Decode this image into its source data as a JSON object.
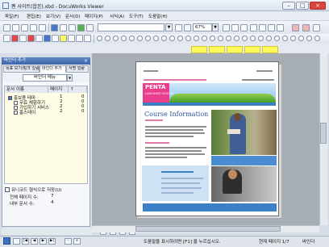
{
  "window": {
    "title": "펜 사이트(합본).xbd - DocuWorks Viewer"
  },
  "menu": {
    "items": [
      "파일(F)",
      "편집(E)",
      "보기(V)",
      "문서(D)",
      "페이지(P)",
      "서식(A)",
      "도구(T)",
      "도움말(H)"
    ]
  },
  "toolbar": {
    "zoom_value": "67%",
    "zoom_arrow": "▼",
    "style_arrow": "▼"
  },
  "left_panel": {
    "title": "바인더 추가",
    "close": "×",
    "tabs": [
      "목표 보기/링크 일람",
      "바인더 추가",
      "서명 일람"
    ],
    "bookmark_dropdown": "바인더 메뉴",
    "dropdown_arrow": "▼",
    "columns": [
      "문서 이름",
      "페이지",
      "↑"
    ],
    "rows": [
      {
        "name": "홍보용 테마",
        "pages": "1",
        "count": "0"
      },
      {
        "name": "무료 체험하기",
        "pages": "2",
        "count": "0"
      },
      {
        "name": "가입하기 서비스",
        "pages": "2",
        "count": "0"
      },
      {
        "name": "홈스테이",
        "pages": "2",
        "count": "0"
      }
    ],
    "option_label": "유니코드 형식으로 저장(U)",
    "info": [
      {
        "label": "전체 페이지 수:",
        "value": "7"
      },
      {
        "label": "내부 문서 수:",
        "value": "4"
      }
    ]
  },
  "document": {
    "brand": "PENTA",
    "brand_sub": "LANGUAGE SCHOOL",
    "heading": "Course Information"
  },
  "status": {
    "help": "도움말을 표시하려면 [F1] 을 누르십시오.",
    "page": "현재 페이지 1/7",
    "zoom_label": "바인더"
  },
  "colors": {
    "accent": "#3b7fc4",
    "brand_pink": "#e83e8c",
    "panel_header": "#3c66a8"
  }
}
